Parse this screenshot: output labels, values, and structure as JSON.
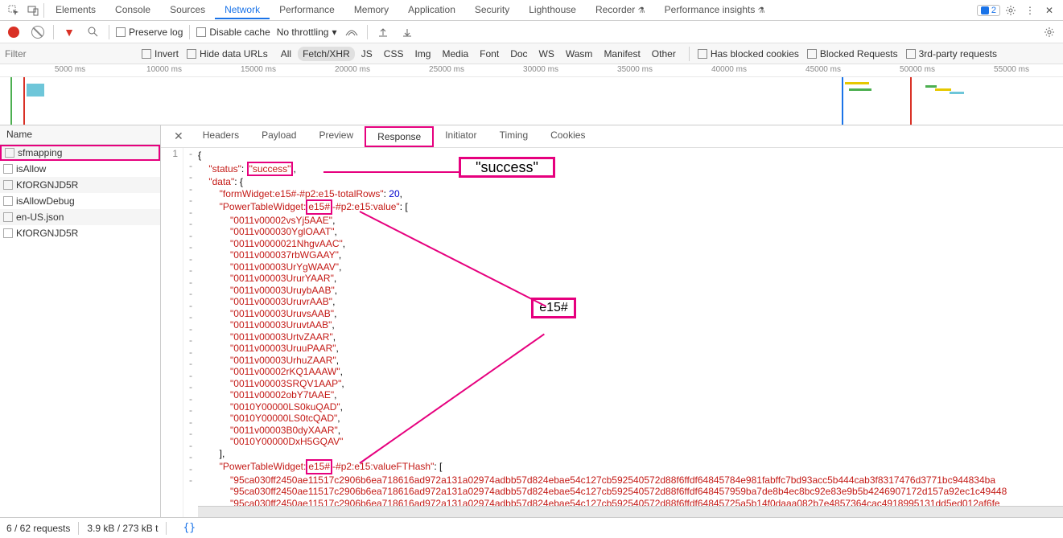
{
  "top": {
    "tabs": [
      "Elements",
      "Console",
      "Sources",
      "Network",
      "Performance",
      "Memory",
      "Application",
      "Security",
      "Lighthouse",
      "Recorder",
      "Performance insights"
    ],
    "active_tab": "Network",
    "badge_count": "2"
  },
  "second": {
    "preserve_log": "Preserve log",
    "disable_cache": "Disable cache",
    "throttle": "No throttling"
  },
  "filter": {
    "placeholder": "Filter",
    "invert": "Invert",
    "hide_urls": "Hide data URLs",
    "types": [
      "All",
      "Fetch/XHR",
      "JS",
      "CSS",
      "Img",
      "Media",
      "Font",
      "Doc",
      "WS",
      "Wasm",
      "Manifest",
      "Other"
    ],
    "active_type": "Fetch/XHR",
    "blocked_cookies": "Has blocked cookies",
    "blocked_requests": "Blocked Requests",
    "third_party": "3rd-party requests"
  },
  "timeline": {
    "ticks": [
      "5000 ms",
      "10000 ms",
      "15000 ms",
      "20000 ms",
      "25000 ms",
      "30000 ms",
      "35000 ms",
      "40000 ms",
      "45000 ms",
      "50000 ms",
      "55000 ms"
    ]
  },
  "requests": {
    "header": "Name",
    "items": [
      "sfmapping",
      "isAllow",
      "KfORGNJD5R",
      "isAllowDebug",
      "en-US.json",
      "KfORGNJD5R"
    ],
    "selected": 0
  },
  "detail": {
    "tabs": [
      "Headers",
      "Payload",
      "Preview",
      "Response",
      "Initiator",
      "Timing",
      "Cookies"
    ],
    "active": "Response"
  },
  "response": {
    "gutter_1": "1",
    "open_brace": "{",
    "status_key": "\"status\"",
    "status_val": "\"success\"",
    "data_key": "\"data\"",
    "totalrows_key": "\"formWidget:e15#-#p2:e15-totalRows\"",
    "totalrows_val": "20",
    "ptw_value_pre": "\"PowerTableWidget:",
    "e15_token": "e15#",
    "ptw_value_post": "-#p2:e15:value\"",
    "value_ids": [
      "\"0011v00002vsYj5AAE\"",
      "\"0011v000030YglOAAT\"",
      "\"0011v0000021NhgvAAC\"",
      "\"0011v000037rbWGAAY\"",
      "\"0011v00003UrYgWAAV\"",
      "\"0011v00003UrurYAAR\"",
      "\"0011v00003UruybAAB\"",
      "\"0011v00003UruvrAAB\"",
      "\"0011v00003UruvsAAB\"",
      "\"0011v00003UruvtAAB\"",
      "\"0011v00003UrtvZAAR\"",
      "\"0011v00003UruuPAAR\"",
      "\"0011v00003UrhuZAAR\"",
      "\"0011v00002rKQ1AAAW\"",
      "\"0011v00003SRQV1AAP\"",
      "\"0011v00002obY7tAAE\"",
      "\"0010Y00000LS0kuQAD\"",
      "\"0010Y00000LS0tcQAD\"",
      "\"0011v00003B0dyXAAR\"",
      "\"0010Y00000DxH5GQAV\""
    ],
    "close_bracket": "],",
    "ptw_hash_post": "-#p2:e15:valueFTHash\"",
    "hashes": [
      "\"95ca030ff2450ae11517c2906b6ea718616ad972a131a02974adbb57d824ebae54c127cb592540572d88f6ffdf64845784e981fabffc7bd93acc5b444cab3f8317476d3771bc944834ba",
      "\"95ca030ff2450ae11517c2906b6ea718616ad972a131a02974adbb57d824ebae54c127cb592540572d88f6ffdf648457959ba7de8b4ec8bc92e83e9b5b4246907172d157a92ec1c49448",
      "\"95ca030ff2450ae11517c2906b6ea718616ad972a131a02974adbb57d824ebae54c127cb592540572d88f6ffdf64845725a5b14f0daaa082b7e4857364cac4918995131dd5ed012af6fe"
    ]
  },
  "annotations": {
    "success_label": "\"success\"",
    "e15_label": "e15#"
  },
  "status": {
    "requests": "6 / 62 requests",
    "transfer": "3.9 kB / 273 kB t"
  }
}
